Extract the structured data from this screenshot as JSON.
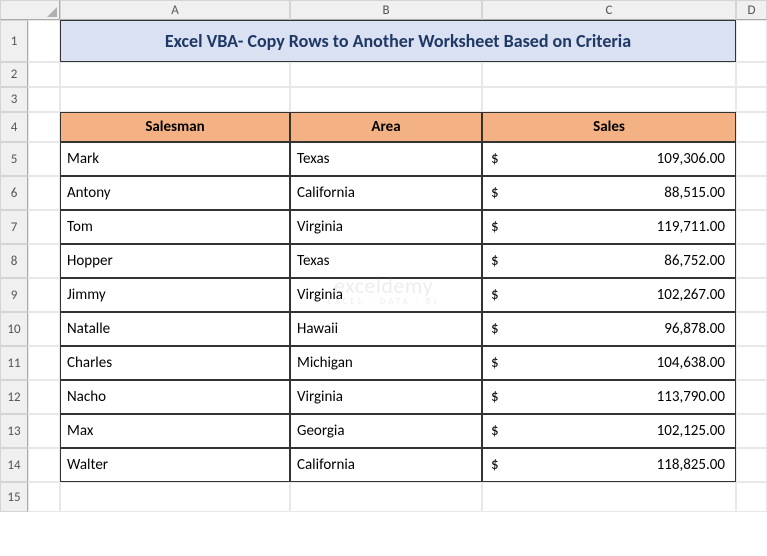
{
  "columns": [
    "A",
    "B",
    "C",
    "D"
  ],
  "rows": [
    "1",
    "2",
    "3",
    "4",
    "5",
    "6",
    "7",
    "8",
    "9",
    "10",
    "11",
    "12",
    "13",
    "14",
    "15"
  ],
  "title": "Excel VBA- Copy Rows to Another Worksheet Based on Criteria",
  "headers": {
    "b": "Salesman",
    "c": "Area",
    "d": "Sales"
  },
  "currency": "$",
  "chart_data": {
    "type": "table",
    "title": "Excel VBA- Copy Rows to Another Worksheet Based on Criteria",
    "columns": [
      "Salesman",
      "Area",
      "Sales"
    ],
    "rows": [
      {
        "salesman": "Mark",
        "area": "Texas",
        "sales": "109,306.00"
      },
      {
        "salesman": "Antony",
        "area": "California",
        "sales": "88,515.00"
      },
      {
        "salesman": "Tom",
        "area": "Virginia",
        "sales": "119,711.00"
      },
      {
        "salesman": "Hopper",
        "area": "Texas",
        "sales": "86,752.00"
      },
      {
        "salesman": "Jimmy",
        "area": "Virginia",
        "sales": "102,267.00"
      },
      {
        "salesman": "Natalle",
        "area": "Hawaii",
        "sales": "96,878.00"
      },
      {
        "salesman": "Charles",
        "area": "Michigan",
        "sales": "104,638.00"
      },
      {
        "salesman": "Nacho",
        "area": "Virginia",
        "sales": "113,790.00"
      },
      {
        "salesman": "Max",
        "area": "Georgia",
        "sales": "102,125.00"
      },
      {
        "salesman": "Walter",
        "area": "California",
        "sales": "118,825.00"
      }
    ]
  },
  "watermark": {
    "main": "exceldemy",
    "sub": "EXCEL · DATA · BI"
  }
}
